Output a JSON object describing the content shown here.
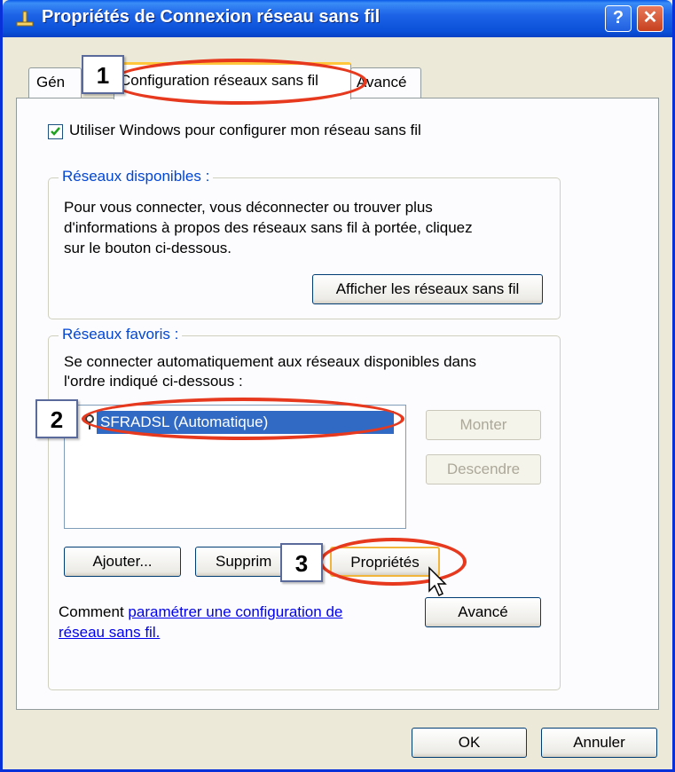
{
  "window": {
    "title": "Propriétés de Connexion réseau sans fil",
    "help_label": "?",
    "close_label": "✕"
  },
  "tabs": [
    {
      "label": "Gén",
      "active": false
    },
    {
      "label": "Configuration réseaux sans fil",
      "active": true
    },
    {
      "label": "Avancé",
      "active": false
    }
  ],
  "checkbox": {
    "label": "Utiliser Windows pour configurer mon réseau sans fil",
    "checked": true
  },
  "available": {
    "legend": "Réseaux disponibles :",
    "text_lines": [
      "Pour vous connecter, vous déconnecter ou trouver plus",
      "d'informations à propos des réseaux sans fil à portée, cliquez",
      "sur le bouton ci-dessous."
    ],
    "button": "Afficher les réseaux sans fil"
  },
  "favorites": {
    "legend": "Réseaux favoris :",
    "text_lines": [
      "Se connecter automatiquement aux réseaux disponibles dans",
      "l'ordre indiqué ci-dessous :"
    ],
    "networks": [
      "SFRADSL (Automatique)"
    ],
    "up_button": "Monter",
    "down_button": "Descendre",
    "add_button": "Ajouter...",
    "remove_button": "Supprim",
    "properties_button": "Propriétés",
    "help_prefix": "Comment ",
    "help_link_1": "paramétrer une configuration de",
    "help_link_2": "réseau sans fil.",
    "advanced_button": "Avancé"
  },
  "footer": {
    "ok_button": "OK",
    "cancel_button": "Annuler"
  },
  "annotations": {
    "step1": "1",
    "step2": "2",
    "step3": "3",
    "highlight_color": "#e6391e"
  }
}
